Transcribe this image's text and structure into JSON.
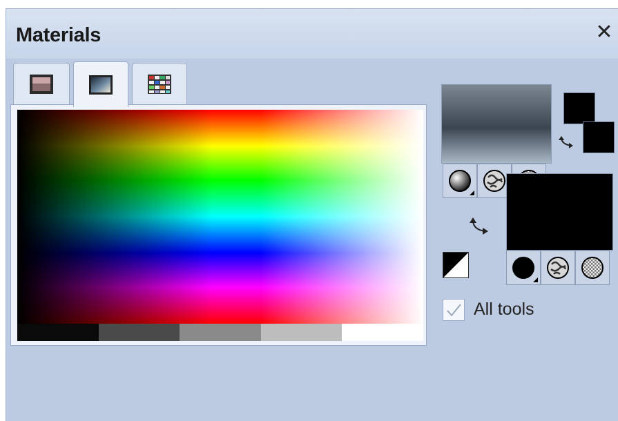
{
  "window": {
    "title": "Materials",
    "close_glyph": "✕"
  },
  "tabs": [
    {
      "name": "frame-tab",
      "icon": "frame-icon",
      "active": false
    },
    {
      "name": "gradient-tab",
      "icon": "gradient-icon",
      "active": true
    },
    {
      "name": "swatches-tab",
      "icon": "swatch-grid-icon",
      "active": false
    }
  ],
  "spectrum": {
    "gray_steps": [
      "#0a0a0a",
      "#4a4a4a",
      "#8a8a8a",
      "#bdbdbd",
      "#ffffff"
    ]
  },
  "foreground": {
    "buttons": [
      "style-color-button",
      "texture-button",
      "pattern-button"
    ]
  },
  "background": {
    "color": "#000000",
    "buttons": [
      "style-color-button",
      "texture-button",
      "pattern-button"
    ]
  },
  "all_tools": {
    "label": "All tools",
    "checked": true
  }
}
